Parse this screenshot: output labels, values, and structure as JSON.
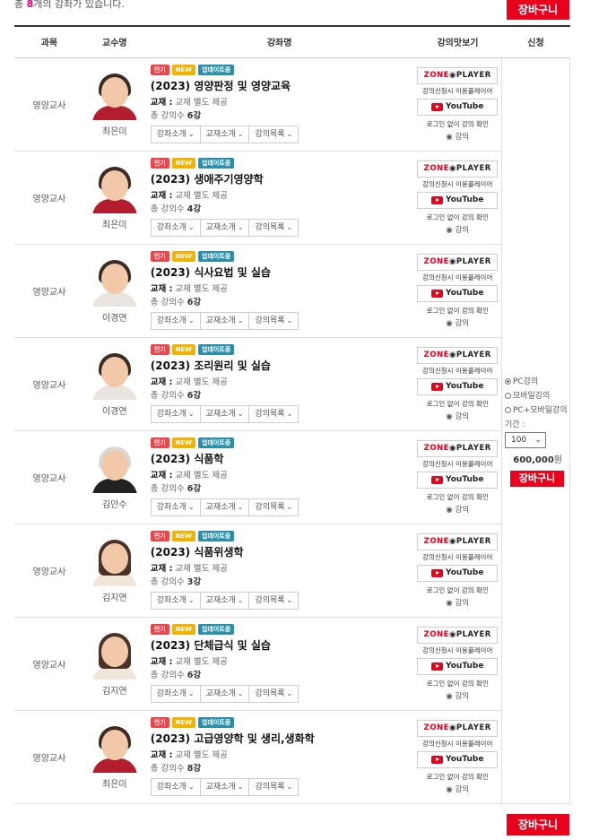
{
  "top": {
    "prefix": "총 ",
    "count": "8",
    "suffix": "개의 강좌가 있습니다.",
    "cart_label": "장바구니"
  },
  "headers": {
    "subject": "과목",
    "professor": "교수명",
    "course": "강좌명",
    "preview": "강의맛보기",
    "apply": "신청"
  },
  "common": {
    "badge_popular": "인기",
    "badge_new": "NEW",
    "badge_update": "업데이트중",
    "book_label": "교재 :",
    "book_value": " 교재 별도 제공",
    "count_prefix": "총 강의수 ",
    "count_suffix": "강",
    "dd_intro": "강좌소개",
    "dd_book": "교재소개",
    "dd_list": "강의목록",
    "zone_a": "ZONE",
    "zone_b": "◉PLAYER",
    "zone_note": "강의신청시 이용플레이어",
    "youtube": "YouTube",
    "login_note": "로그인 없이 강의 확인",
    "radio_lecture": "◉ 강의"
  },
  "courses": [
    {
      "subject": "영양교사",
      "professor": "최은미",
      "title": "(2023) 영양판정 및 영양교육",
      "lectures": "6"
    },
    {
      "subject": "영양교사",
      "professor": "최은미",
      "title": "(2023) 생애주기영양학",
      "lectures": "4"
    },
    {
      "subject": "영양교사",
      "professor": "이경연",
      "title": "(2023) 식사요법 및 실습",
      "lectures": "6"
    },
    {
      "subject": "영양교사",
      "professor": "이경연",
      "title": "(2023) 조리원리 및 실습",
      "lectures": "6"
    },
    {
      "subject": "영양교사",
      "professor": "김만수",
      "title": "(2023) 식품학",
      "lectures": "6"
    },
    {
      "subject": "영양교사",
      "professor": "김지연",
      "title": "(2023) 식품위생학",
      "lectures": "3"
    },
    {
      "subject": "영양교사",
      "professor": "김지연",
      "title": "(2023) 단체급식 및 실습",
      "lectures": "6"
    },
    {
      "subject": "영양교사",
      "professor": "최은미",
      "title": "(2023) 고급영양학 및 생리,생화학",
      "lectures": "8"
    }
  ],
  "apply": {
    "opt_pc": "PC강의",
    "opt_mobile": "모바일강의",
    "opt_both": "PC+모바일강의",
    "period_label": "기간 :",
    "period_value": "100",
    "price": "600,000",
    "price_unit": "원",
    "cart_label": "장바구니"
  },
  "bottom": {
    "cart_label": "장바구니"
  }
}
